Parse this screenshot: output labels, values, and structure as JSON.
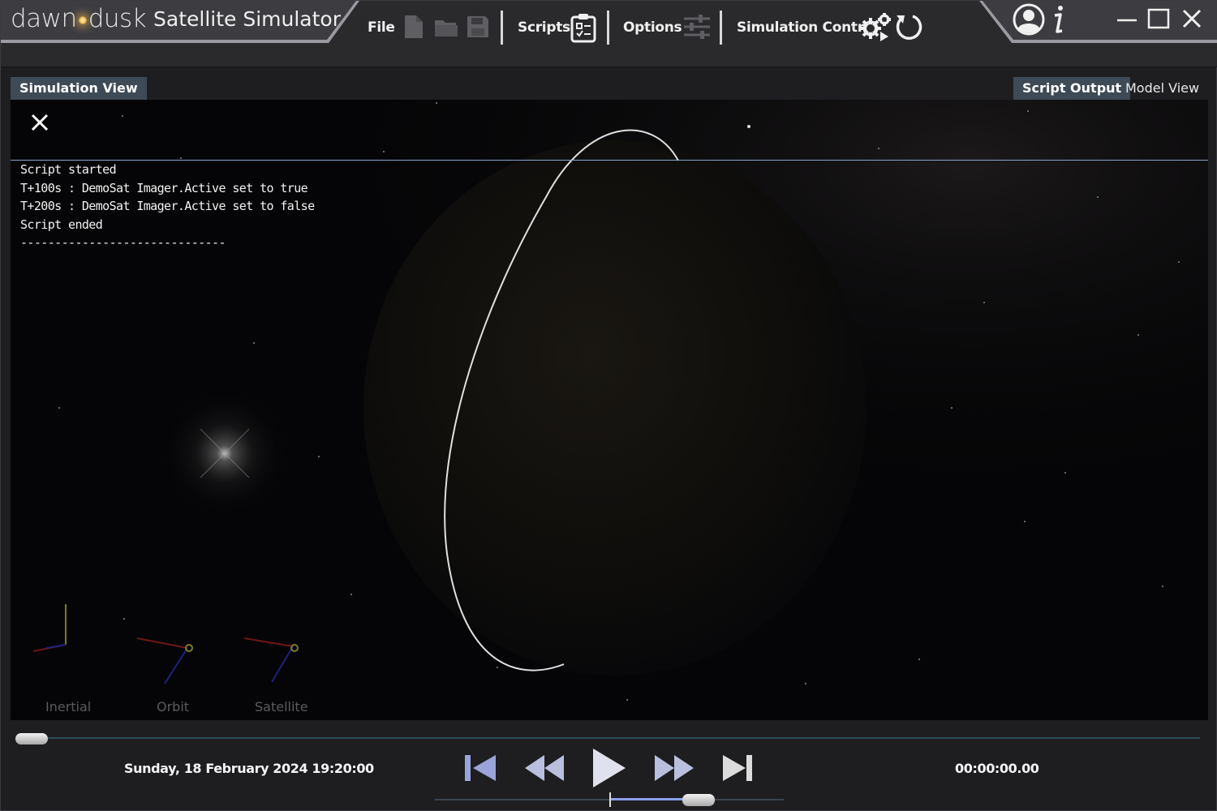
{
  "app": {
    "logo_left": "dawn",
    "logo_right": "dusk",
    "title": "Satellite Simulator"
  },
  "menu": {
    "file": "File",
    "scripts": "Scripts",
    "options": "Options",
    "simulation_control": "Simulation Control"
  },
  "tabs": {
    "simulation_view": "Simulation View",
    "script_output": "Script Output",
    "model_view": "Model View"
  },
  "script_output": {
    "lines": [
      "Script started",
      "T+100s : DemoSat Imager.Active set to true",
      "T+200s : DemoSat Imager.Active set to false",
      "Script ended",
      "------------------------------"
    ]
  },
  "axes": {
    "inertial": "Inertial",
    "orbit": "Orbit",
    "satellite": "Satellite"
  },
  "playback": {
    "date": "Sunday, 18 February 2024 19:20:00",
    "elapsed": "00:00:00.00",
    "timeline_position": 0.0
  },
  "colors": {
    "accent_tab": "#3e4a56",
    "panel_border": "#8aa4c8",
    "speed_fill": "#8aa0e8"
  },
  "icons": [
    "new-file-icon",
    "open-folder-icon",
    "save-icon",
    "clipboard-icon",
    "sliders-icon",
    "gears-icon",
    "reset-icon",
    "user-icon",
    "info-icon",
    "minimize-icon",
    "maximize-icon",
    "close-icon",
    "skip-start-icon",
    "rewind-icon",
    "play-icon",
    "fast-forward-icon",
    "skip-end-icon"
  ]
}
